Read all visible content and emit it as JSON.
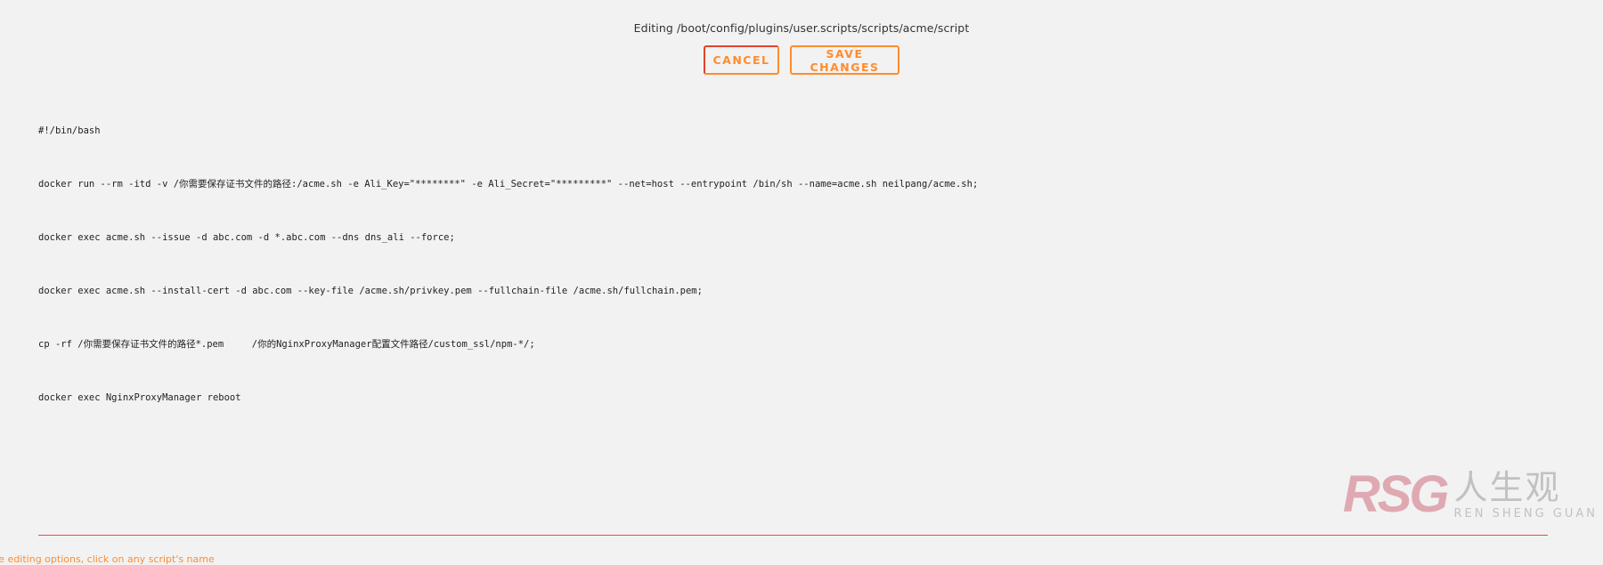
{
  "header": {
    "title": "Editing /boot/config/plugins/user.scripts/scripts/acme/script"
  },
  "toolbar": {
    "cancel_label": "CANCEL",
    "save_label": "SAVE CHANGES"
  },
  "editor": {
    "lines": [
      "#!/bin/bash",
      "docker run --rm -itd -v /你需要保存证书文件的路径:/acme.sh -e Ali_Key=\"********\" -e Ali_Secret=\"*********\" --net=host --entrypoint /bin/sh --name=acme.sh neilpang/acme.sh;",
      "docker exec acme.sh --issue -d abc.com -d *.abc.com --dns dns_ali --force;",
      "docker exec acme.sh --install-cert -d abc.com --key-file /acme.sh/privkey.pem --fullchain-file /acme.sh/fullchain.pem;",
      "cp -rf /你需要保存证书文件的路径*.pem     /你的NginxProxyManager配置文件路径/custom_ssl/npm-*/;",
      "docker exec NginxProxyManager reboot"
    ]
  },
  "footer": {
    "hint": "re editing options, click on any script's name"
  },
  "watermark": {
    "logo_text": "RSG",
    "cn_text": "人生观",
    "en_text": "REN SHENG GUAN"
  },
  "colors": {
    "accent": "#ff8c2f",
    "divider": "#e0503c",
    "background": "#f2f2f2"
  }
}
